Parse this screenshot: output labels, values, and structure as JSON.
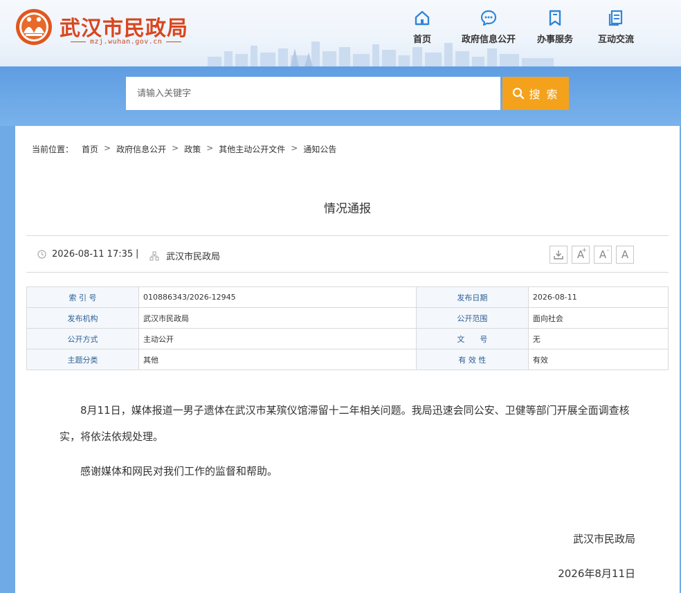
{
  "header": {
    "site_title": "武汉市民政局",
    "site_url": "mzj.wuhan.gov.cn",
    "nav": [
      {
        "label": "首页",
        "icon": "home-icon"
      },
      {
        "label": "政府信息公开",
        "icon": "chat-bubble-icon"
      },
      {
        "label": "办事服务",
        "icon": "bookmark-icon"
      },
      {
        "label": "互动交流",
        "icon": "document-icon"
      }
    ]
  },
  "search": {
    "placeholder": "请输入关键字",
    "button_label": "搜 索"
  },
  "breadcrumb": {
    "label": "当前位置：",
    "items": [
      "首页",
      "政府信息公开",
      "政策",
      "其他主动公开文件",
      "通知公告"
    ]
  },
  "article": {
    "title": "情况通报",
    "datetime": "2026-08-11 17:35",
    "divider": "|",
    "source": "武汉市民政局",
    "tools": [
      "download-icon",
      "font-increase-icon",
      "font-decrease-icon",
      "font-reset-icon"
    ],
    "tool_labels": {
      "increase": "A",
      "plus": "+",
      "minus": "-",
      "reset": "A"
    }
  },
  "info_table": [
    {
      "k1": "索 引 号",
      "v1": "010886343/2026-12945",
      "k2": "发布日期",
      "v2": "2026-08-11"
    },
    {
      "k1": "发布机构",
      "v1": "武汉市民政局",
      "k2": "公开范围",
      "v2": "面向社会"
    },
    {
      "k1": "公开方式",
      "v1": "主动公开",
      "k2": "文　　号",
      "v2": "无"
    },
    {
      "k1": "主题分类",
      "v1": "其他",
      "k2": "有 效 性",
      "v2": "有效"
    }
  ],
  "body": {
    "paragraphs": [
      "8月11日，媒体报道一男子遗体在武汉市某殡仪馆滞留十二年相关问题。我局迅速会同公安、卫健等部门开展全面调查核实，将依法依规处理。",
      "感谢媒体和网民对我们工作的监督和帮助。"
    ],
    "signature_org": "武汉市民政局",
    "signature_date": "2026年8月11日"
  },
  "colors": {
    "brand_red": "#d9461f",
    "nav_icon_blue": "#2f86d8",
    "search_button": "#f4a21c",
    "table_key": "#2c5e94"
  }
}
